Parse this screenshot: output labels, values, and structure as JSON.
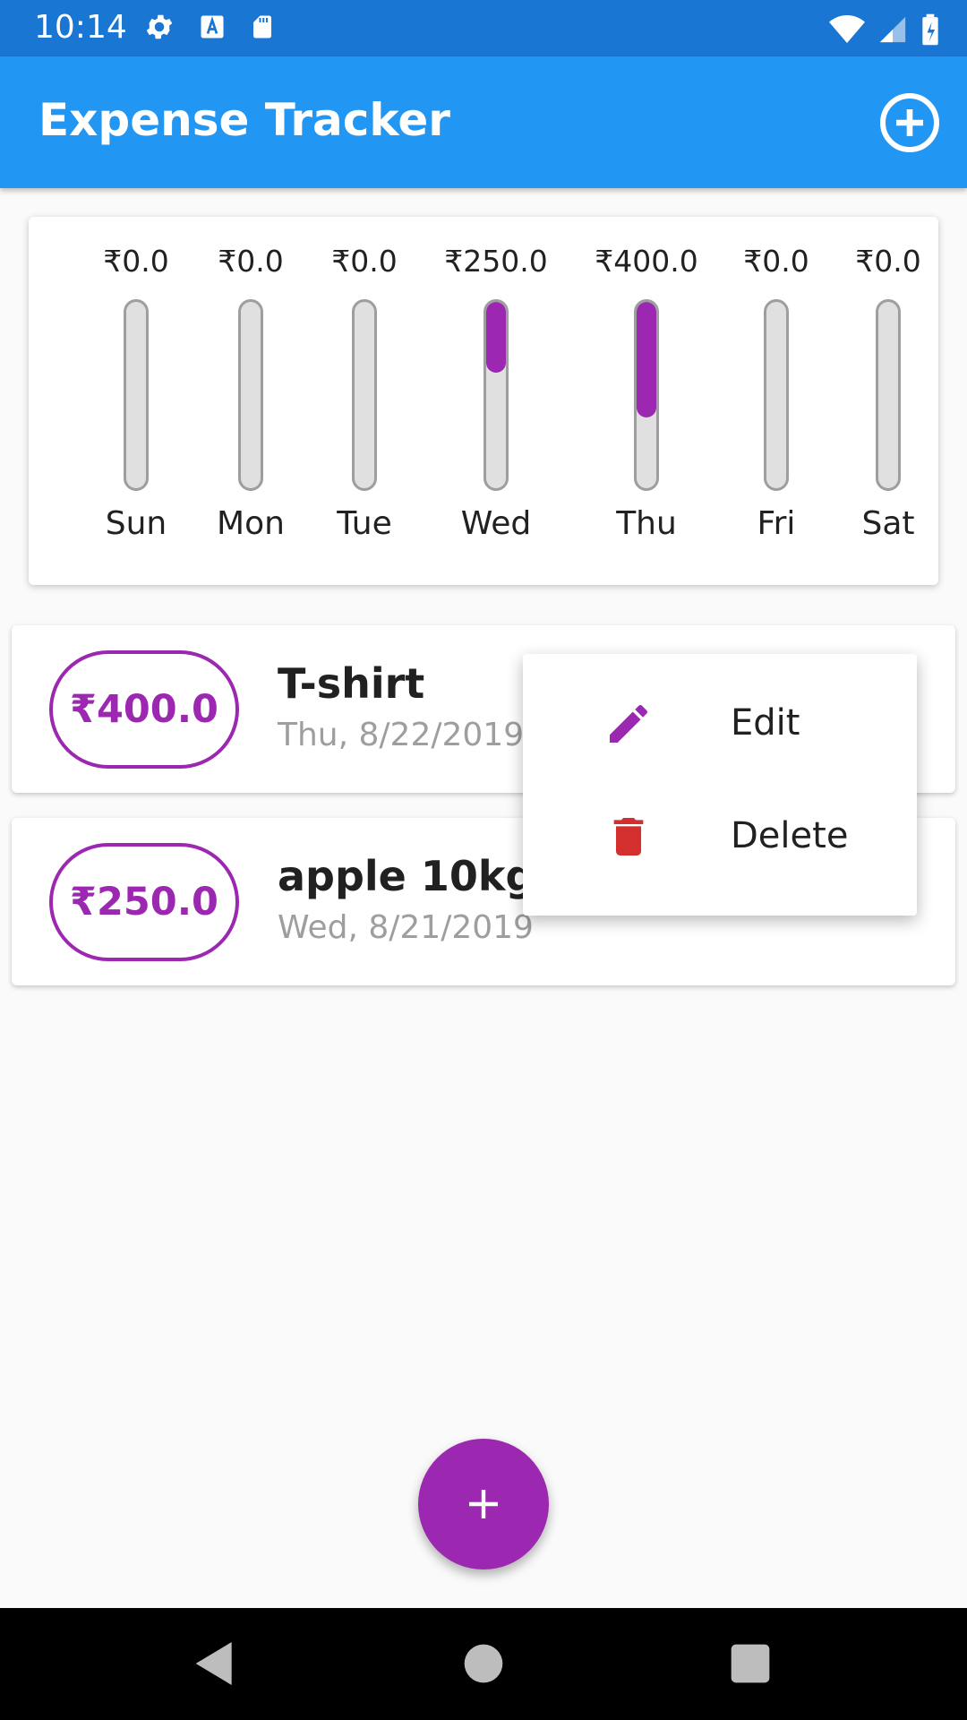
{
  "status_bar": {
    "time": "10:14",
    "left_icons": [
      "gear-icon",
      "a-icon",
      "sd-card-icon"
    ],
    "right_icons": [
      "wifi-icon",
      "signal-icon",
      "battery-icon"
    ]
  },
  "app_bar": {
    "title": "Expense Tracker",
    "action_icon": "add-circle-icon"
  },
  "chart_data": {
    "type": "bar",
    "categories": [
      "Sun",
      "Mon",
      "Tue",
      "Wed",
      "Thu",
      "Fri",
      "Sat"
    ],
    "values": [
      0.0,
      0.0,
      0.0,
      250.0,
      400.0,
      0.0,
      0.0
    ],
    "amount_labels": [
      "₹0.0",
      "₹0.0",
      "₹0.0",
      "₹250.0",
      "₹400.0",
      "₹0.0",
      "₹0.0"
    ],
    "share_of_week": [
      0,
      0,
      0,
      0.38,
      0.62,
      0,
      0
    ]
  },
  "transactions": [
    {
      "amount": "₹400.0",
      "title": "T-shirt",
      "date": "Thu, 8/22/2019"
    },
    {
      "amount": "₹250.0",
      "title": "apple 10kg",
      "date": "Wed, 8/21/2019"
    }
  ],
  "popup_menu": {
    "items": [
      {
        "label": "Edit",
        "icon": "pencil-icon"
      },
      {
        "label": "Delete",
        "icon": "trash-icon"
      }
    ]
  },
  "fab": {
    "icon": "plus-icon"
  },
  "colors": {
    "status_bar": "#1976d2",
    "app_bar": "#2196f3",
    "accent": "#9c27b0",
    "delete": "#d32f2f"
  }
}
